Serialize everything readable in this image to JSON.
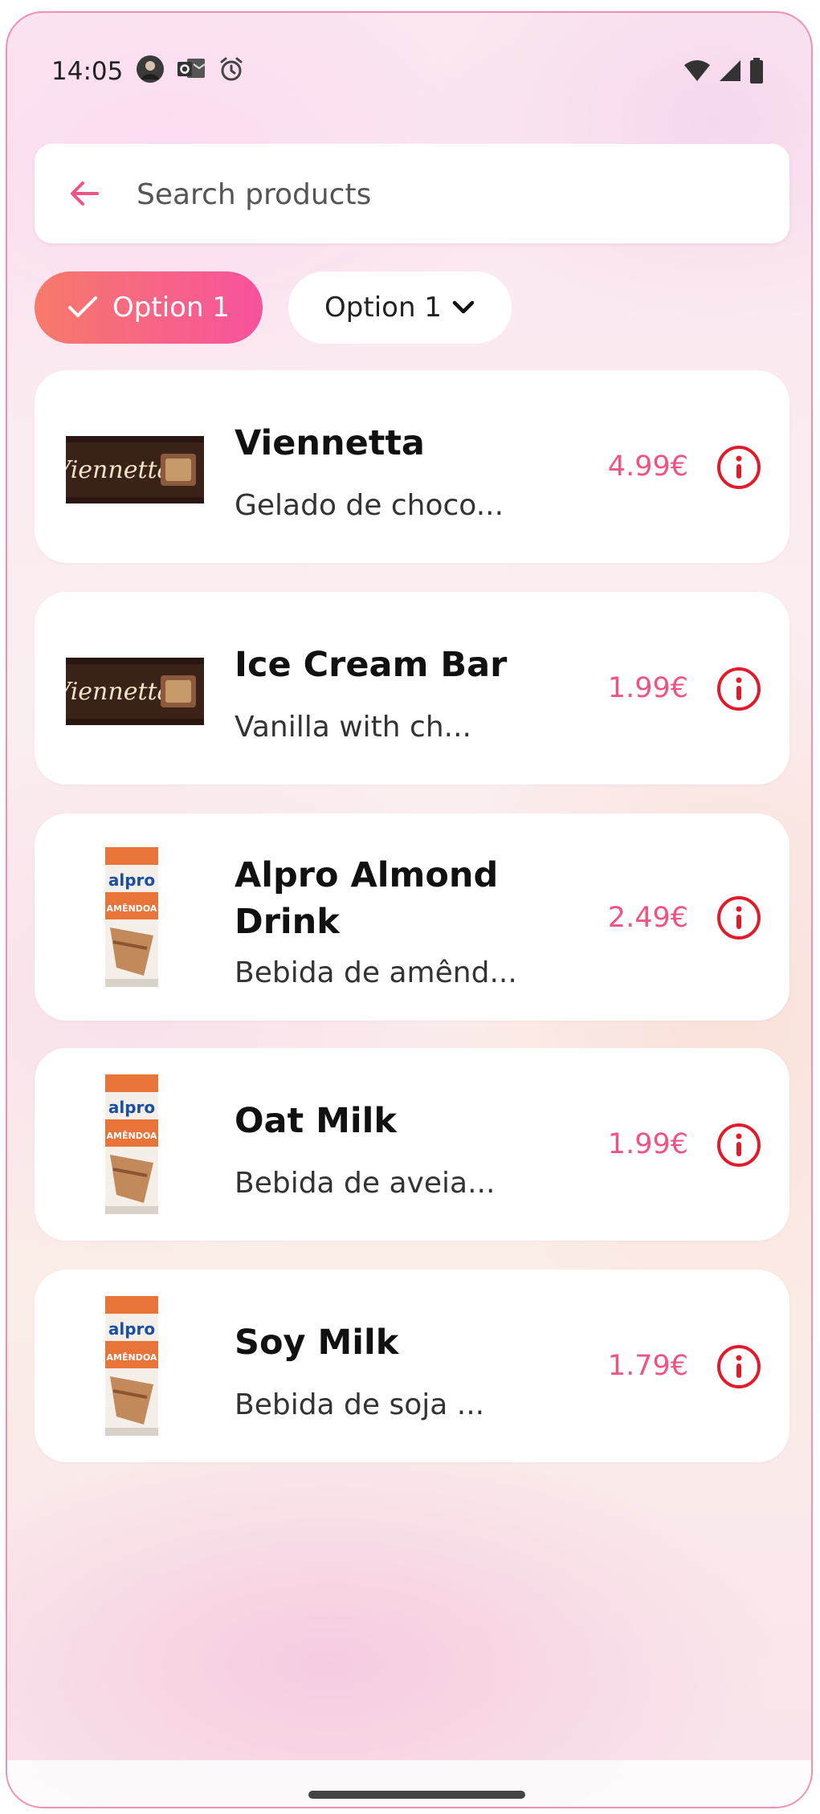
{
  "status_bar": {
    "time": "14:05"
  },
  "search": {
    "placeholder": "Search products"
  },
  "filters": {
    "selected_chip": "Option 1",
    "dropdown_chip": "Option 1"
  },
  "products": [
    {
      "name": "Viennetta",
      "description": "Gelado de choco...",
      "price": "4.99€"
    },
    {
      "name": "Ice Cream Bar",
      "description": "Vanilla with ch...",
      "price": "1.99€"
    },
    {
      "name": "Alpro Almond Drink",
      "description": "Bebida de amênd...",
      "price": "2.49€"
    },
    {
      "name": "Oat Milk",
      "description": "Bebida de aveia...",
      "price": "1.99€"
    },
    {
      "name": "Soy Milk",
      "description": "Bebida de soja ...",
      "price": "1.79€"
    }
  ],
  "product_images": {
    "viennetta_label": "Viennetta",
    "alpro_brand": "alpro",
    "alpro_variant": "AMÊNDOA"
  },
  "colors": {
    "accent": "#ee5582",
    "info_icon": "#e01b2a",
    "chip_gradient_start": "#f77a6a",
    "chip_gradient_end": "#f7529e"
  },
  "icons": {
    "back": "arrow-left-icon",
    "check": "check-icon",
    "dropdown": "chevron-down-icon",
    "info": "info-circle-icon"
  }
}
